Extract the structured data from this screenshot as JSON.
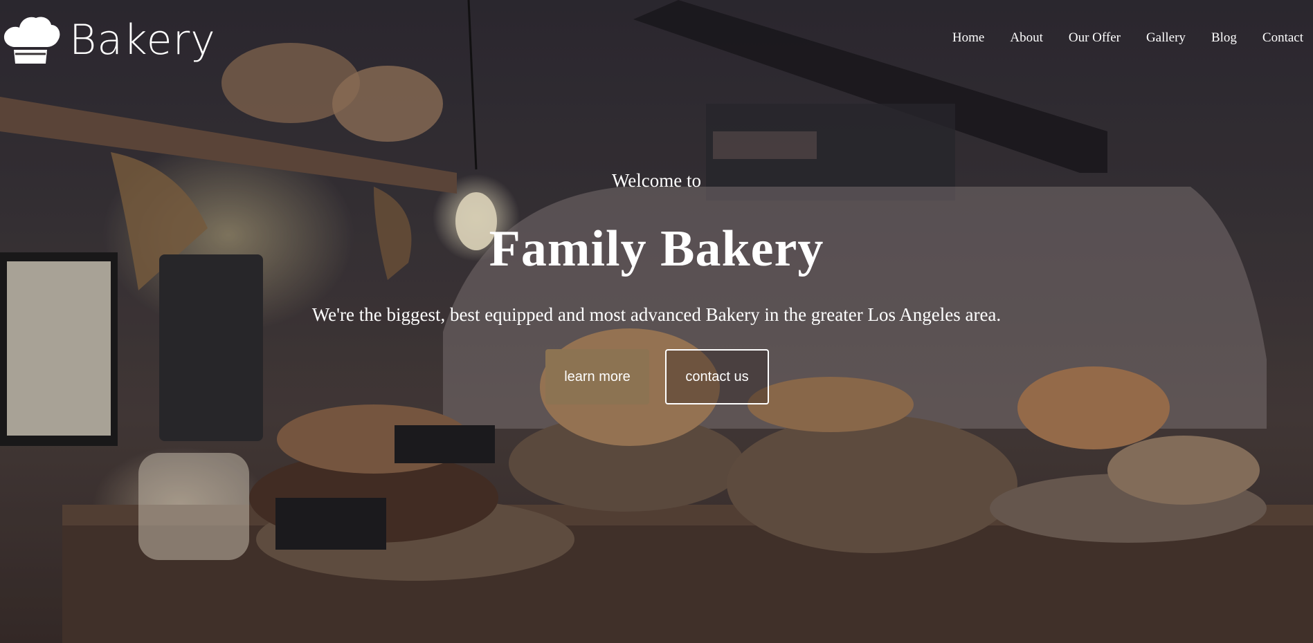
{
  "brand": {
    "name": "Bakery",
    "icon": "chef-hat-icon"
  },
  "nav": {
    "items": [
      {
        "label": "Home"
      },
      {
        "label": "About"
      },
      {
        "label": "Our Offer"
      },
      {
        "label": "Gallery"
      },
      {
        "label": "Blog"
      },
      {
        "label": "Contact"
      }
    ]
  },
  "hero": {
    "welcome": "Welcome to",
    "title": "Family Bakery",
    "subtitle": "We're the biggest, best equipped and most advanced Bakery in the greater Los Angeles area.",
    "buttons": {
      "learn_more": "learn more",
      "contact_us": "contact us"
    }
  },
  "colors": {
    "accent": "#8c7352",
    "text": "#ffffff"
  }
}
